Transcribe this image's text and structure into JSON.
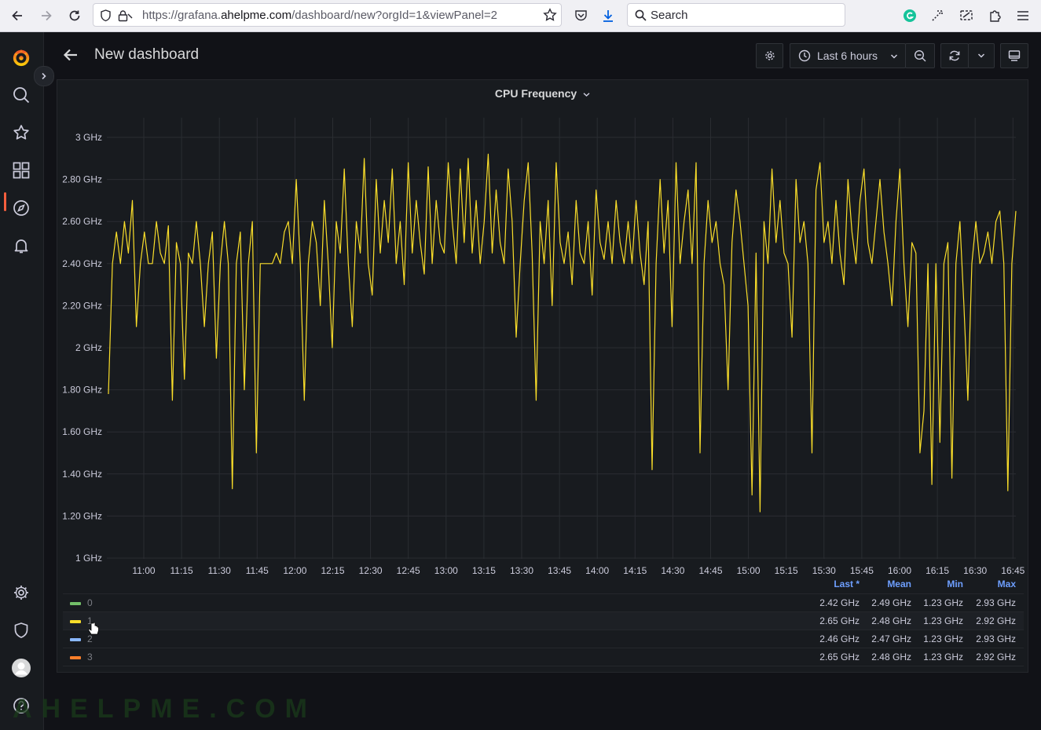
{
  "browser": {
    "url_prefix": "https://grafana.",
    "url_domain": "ahelpme.com",
    "url_suffix": "/dashboard/new?orgId=1&viewPanel=2",
    "search_placeholder": "Search"
  },
  "sidebar": {
    "items": [
      "grafana-logo-icon",
      "search-icon",
      "star-icon",
      "dashboards-icon",
      "explore-icon",
      "alerting-icon",
      "configuration-icon",
      "server-admin-icon",
      "profile-icon",
      "help-icon"
    ]
  },
  "header": {
    "title": "New dashboard",
    "time_range": "Last 6 hours"
  },
  "panel": {
    "title": "CPU Frequency"
  },
  "legend": {
    "headers": {
      "last": "Last *",
      "mean": "Mean",
      "min": "Min",
      "max": "Max"
    },
    "rows": [
      {
        "name": "0",
        "color": "#73bf69",
        "last": "2.42 GHz",
        "mean": "2.49 GHz",
        "min": "1.23 GHz",
        "max": "2.93 GHz"
      },
      {
        "name": "1",
        "color": "#fade2a",
        "last": "2.65 GHz",
        "mean": "2.48 GHz",
        "min": "1.23 GHz",
        "max": "2.92 GHz"
      },
      {
        "name": "2",
        "color": "#8ab8ff",
        "last": "2.46 GHz",
        "mean": "2.47 GHz",
        "min": "1.23 GHz",
        "max": "2.93 GHz"
      },
      {
        "name": "3",
        "color": "#ff7f2a",
        "last": "2.65 GHz",
        "mean": "2.48 GHz",
        "min": "1.23 GHz",
        "max": "2.92 GHz"
      }
    ]
  },
  "chart_data": {
    "type": "line",
    "title": "CPU Frequency",
    "y_ticks": [
      "1 GHz",
      "1.20 GHz",
      "1.40 GHz",
      "1.60 GHz",
      "1.80 GHz",
      "2 GHz",
      "2.20 GHz",
      "2.40 GHz",
      "2.60 GHz",
      "2.80 GHz",
      "3 GHz"
    ],
    "ylim": [
      1.0,
      3.1
    ],
    "x_ticks": [
      "11:00",
      "11:15",
      "11:30",
      "11:45",
      "12:00",
      "12:15",
      "12:30",
      "12:45",
      "13:00",
      "13:15",
      "13:30",
      "13:45",
      "14:00",
      "14:15",
      "14:30",
      "14:45",
      "15:00",
      "15:15",
      "15:30",
      "15:45",
      "16:00",
      "16:15",
      "16:30",
      "16:45"
    ],
    "grid": true,
    "highlighted_series": "1",
    "series": [
      {
        "name": "1",
        "color": "#fade2a",
        "values": [
          1.78,
          2.4,
          2.55,
          2.4,
          2.6,
          2.45,
          2.7,
          2.1,
          2.4,
          2.55,
          2.4,
          2.4,
          2.6,
          2.45,
          2.4,
          2.58,
          1.75,
          2.5,
          2.4,
          1.85,
          2.45,
          2.4,
          2.6,
          2.4,
          2.1,
          2.4,
          2.55,
          1.95,
          2.4,
          2.6,
          2.4,
          1.33,
          2.4,
          2.55,
          1.8,
          2.4,
          2.6,
          1.5,
          2.4,
          2.4,
          2.4,
          2.4,
          2.45,
          2.4,
          2.55,
          2.6,
          2.4,
          2.8,
          2.4,
          1.75,
          2.4,
          2.6,
          2.5,
          2.2,
          2.7,
          2.4,
          2.0,
          2.6,
          2.45,
          2.85,
          2.4,
          2.1,
          2.6,
          2.45,
          2.9,
          2.4,
          2.25,
          2.8,
          2.45,
          2.7,
          2.5,
          2.85,
          2.4,
          2.6,
          2.3,
          2.88,
          2.45,
          2.7,
          2.5,
          2.35,
          2.86,
          2.4,
          2.7,
          2.5,
          2.45,
          2.88,
          2.6,
          2.4,
          2.85,
          2.5,
          2.9,
          2.45,
          2.7,
          2.4,
          2.6,
          2.92,
          2.45,
          2.75,
          2.5,
          2.4,
          2.85,
          2.6,
          2.05,
          2.4,
          2.7,
          2.88,
          2.45,
          1.75,
          2.6,
          2.4,
          2.7,
          2.2,
          2.88,
          2.5,
          2.4,
          2.55,
          2.3,
          2.7,
          2.45,
          2.4,
          2.6,
          2.25,
          2.75,
          2.5,
          2.42,
          2.6,
          2.4,
          2.7,
          2.5,
          2.4,
          2.6,
          2.4,
          2.7,
          2.45,
          2.3,
          2.6,
          1.42,
          2.4,
          2.8,
          2.45,
          2.7,
          2.1,
          2.88,
          2.4,
          2.6,
          2.75,
          2.4,
          2.88,
          1.5,
          2.4,
          2.7,
          2.5,
          2.6,
          2.4,
          2.3,
          1.8,
          2.5,
          2.75,
          2.6,
          2.4,
          2.2,
          1.3,
          2.45,
          1.22,
          2.6,
          2.4,
          2.85,
          2.5,
          2.7,
          2.45,
          2.4,
          2.05,
          2.8,
          2.5,
          2.6,
          2.4,
          1.5,
          2.75,
          2.88,
          2.5,
          2.6,
          2.4,
          2.7,
          2.45,
          2.3,
          2.8,
          2.55,
          2.4,
          2.7,
          2.85,
          2.5,
          2.4,
          2.6,
          2.8,
          2.55,
          2.4,
          2.2,
          2.6,
          2.85,
          2.4,
          2.1,
          2.5,
          2.45,
          1.5,
          1.7,
          2.4,
          1.35,
          2.4,
          1.55,
          2.4,
          2.5,
          1.38,
          2.4,
          2.6,
          2.2,
          1.75,
          2.4,
          2.6,
          2.4,
          2.45,
          2.55,
          2.4,
          2.6,
          2.65,
          2.4,
          1.32,
          2.4,
          2.65
        ]
      }
    ]
  }
}
